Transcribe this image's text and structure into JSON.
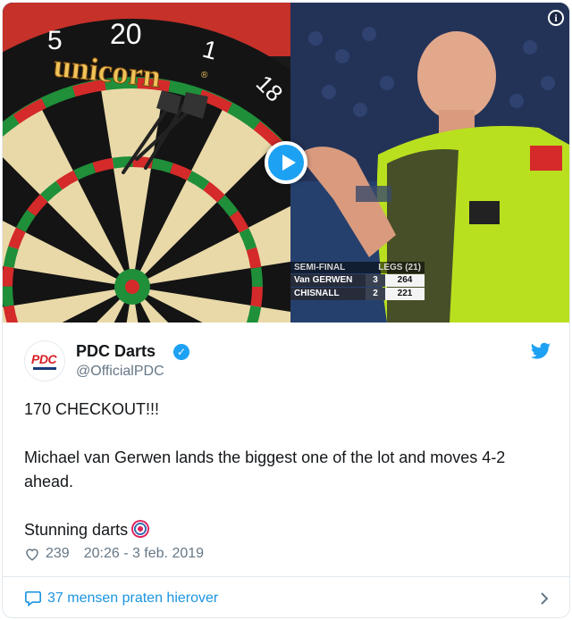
{
  "media": {
    "board_numbers": [
      "5",
      "20",
      "1",
      "18"
    ],
    "board_sponsor": "unicorn",
    "sponsor_mark": "®",
    "scoreboard": {
      "stage": "SEMI-FINAL",
      "legs_header": "LEGS",
      "format": "(21)",
      "players": [
        {
          "name": "Van GERWEN",
          "legs": "3",
          "score": "264"
        },
        {
          "name": "CHISNALL",
          "legs": "2",
          "score": "221"
        }
      ]
    },
    "info_label": "i"
  },
  "tweet": {
    "avatar_text": "PDC",
    "display_name": "PDC Darts",
    "handle": "@OfficialPDC",
    "verified_mark": "✓",
    "paragraphs": [
      "170 CHECKOUT!!!",
      "Michael van Gerwen lands the biggest one of the lot and moves 4-2 ahead.",
      "Stunning darts"
    ],
    "likes": "239",
    "timestamp": "20:26 - 3 feb. 2019",
    "footer_link": "37 mensen praten hierover"
  },
  "colors": {
    "twitter_blue": "#1da1f2",
    "link_blue": "#1b95e0",
    "text_dark": "#14171a",
    "text_gray": "#657786",
    "dartboard_red": "#d42a2a",
    "dartboard_green": "#1f8f3a",
    "shirt_green": "#b9e01f"
  },
  "icons": [
    "play-icon",
    "info-icon",
    "verified-icon",
    "twitter-bird-icon",
    "heart-icon",
    "target-emoji-icon",
    "comment-icon",
    "chevron-right-icon"
  ]
}
